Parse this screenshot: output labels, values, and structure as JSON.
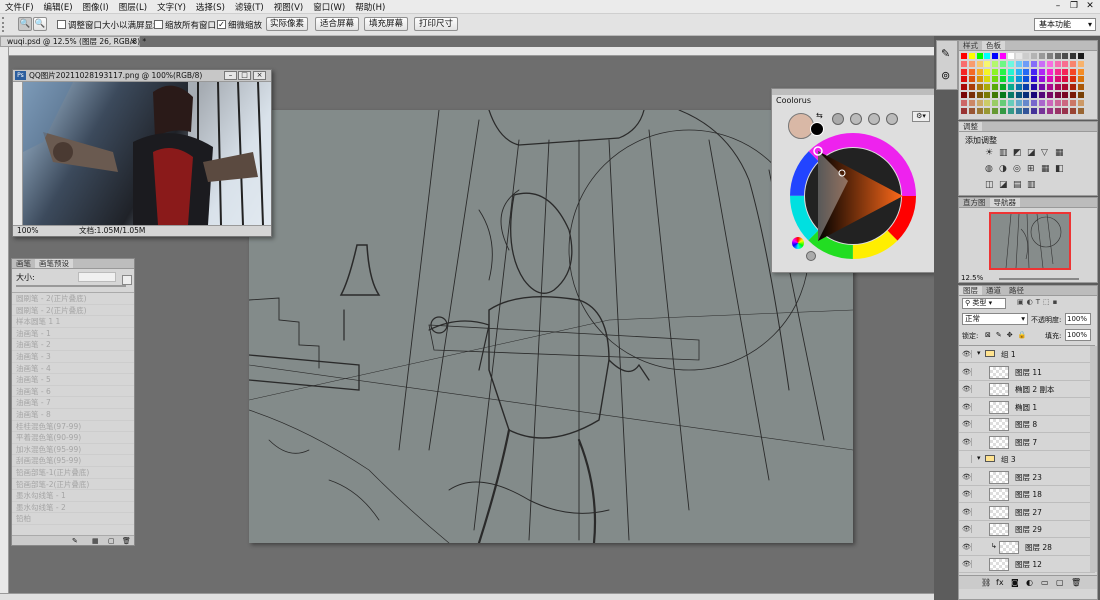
{
  "menu": [
    "文件(F)",
    "编辑(E)",
    "图像(I)",
    "图层(L)",
    "文字(Y)",
    "选择(S)",
    "滤镜(T)",
    "视图(V)",
    "窗口(W)",
    "帮助(H)"
  ],
  "options": {
    "zoom_tool_1": "🔍",
    "zoom_tool_2": "🔍",
    "resize_windows_label": "调整窗口大小以满屏显示",
    "zoom_all_label": "缩放所有窗口",
    "scrubby_label": "细微缩放",
    "scrubby_checked": "✓",
    "btn_actual": "实际像素",
    "btn_fit": "适合屏幕",
    "btn_fill": "填充屏幕",
    "btn_print": "打印尺寸",
    "workspace": "基本功能"
  },
  "document_tab": "wuqi.psd @ 12.5% (图层 26, RGB/8) *",
  "reference_window": {
    "title": "QQ图片20211028193117.png @ 100%(RGB/8)",
    "zoom": "100%",
    "doc_info": "文档:1.05M/1.05M"
  },
  "brush_panel": {
    "tabs": [
      "画笔",
      "画笔预设"
    ],
    "size_label": "大小:",
    "items": [
      "圆刷笔 - 2(正片叠底)",
      "圆刷笔 - 2(正片叠底)",
      "样本圆笔 1 1",
      "油画笔 - 1",
      "油画笔 - 2",
      "油画笔 - 3",
      "油画笔 - 4",
      "油画笔 - 5",
      "油画笔 - 6",
      "油画笔 - 7",
      "油画笔 - 8",
      "桂桂混色笔(97-99)",
      "平着混色笔(90-99)",
      "加水混色笔(95-99)",
      "刮画混色笔(95-99)",
      "铅画部笔-1(正片叠底)",
      "铅画部笔-2(正片叠底)",
      "墨水勾线笔 - 1",
      "墨水勾线笔 - 2",
      "铅柏"
    ]
  },
  "coolorus": {
    "title": "Coolorus"
  },
  "color_panel": {
    "tabs": [
      "样式",
      "色板"
    ]
  },
  "adjust_panel": {
    "tab": "调整",
    "add_label": "添加调整"
  },
  "navigator": {
    "tabs": [
      "直方图",
      "导航器"
    ],
    "zoom": "12.5%"
  },
  "layers_panel": {
    "tabs": [
      "图层",
      "通道",
      "路径"
    ],
    "filter": "类型",
    "blend": "正常",
    "opacity_label": "不透明度:",
    "opacity": "100%",
    "lock_label": "锁定:",
    "fill_label": "填充:",
    "fill": "100%",
    "rows": [
      {
        "name": "组 1",
        "type": "group",
        "visible": "👁"
      },
      {
        "name": "图层 11",
        "type": "layer",
        "visible": "👁"
      },
      {
        "name": "椭圆 2 副本",
        "type": "layer",
        "visible": "👁"
      },
      {
        "name": "椭圆 1",
        "type": "layer",
        "visible": "👁"
      },
      {
        "name": "图层 8",
        "type": "layer",
        "visible": "👁"
      },
      {
        "name": "图层 7",
        "type": "layer",
        "visible": "👁"
      },
      {
        "name": "组 3",
        "type": "group",
        "visible": ""
      },
      {
        "name": "图层 23",
        "type": "layer",
        "visible": "👁"
      },
      {
        "name": "图层 18",
        "type": "layer",
        "visible": "👁"
      },
      {
        "name": "图层 27",
        "type": "layer",
        "visible": "👁"
      },
      {
        "name": "图层 29",
        "type": "layer",
        "visible": "👁"
      },
      {
        "name": "图层 28",
        "type": "clip",
        "visible": "👁"
      },
      {
        "name": "图层 12",
        "type": "layer",
        "visible": "👁"
      }
    ],
    "footer_icons": [
      "link-icon",
      "fx-icon",
      "mask-icon",
      "adjustment-icon",
      "folder-icon",
      "new-layer-icon",
      "trash-icon"
    ]
  },
  "colors": {
    "foreground": "#d9b8a6",
    "canvas": "#838b8a"
  }
}
